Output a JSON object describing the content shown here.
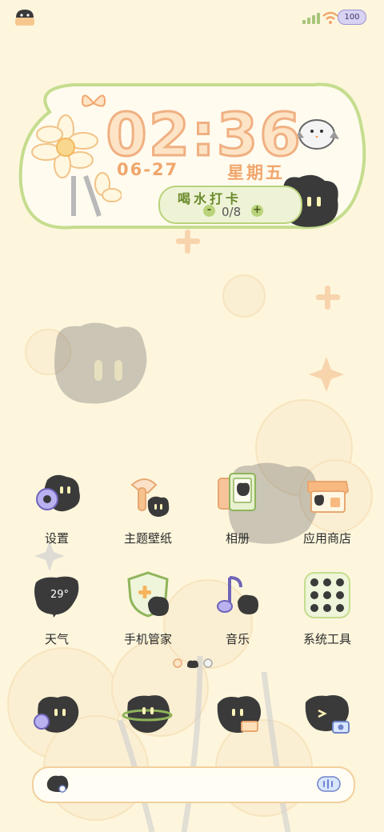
{
  "status_bar": {
    "battery_level": "100",
    "icons": [
      "signal-icon",
      "wifi-icon",
      "battery-icon"
    ]
  },
  "clock_widget": {
    "time": "02:36",
    "date": "06-27",
    "weekday": "星期五",
    "water": {
      "label": "喝水打卡",
      "count": "0/8",
      "minus": "-",
      "plus": "+"
    }
  },
  "apps": [
    {
      "label": "设置",
      "icon": "settings-gear-icon"
    },
    {
      "label": "主题壁纸",
      "icon": "paint-brush-icon"
    },
    {
      "label": "相册",
      "icon": "photo-album-icon"
    },
    {
      "label": "应用商店",
      "icon": "app-store-icon"
    },
    {
      "label": "天气",
      "icon": "weather-icon",
      "temperature": "29°"
    },
    {
      "label": "手机管家",
      "icon": "phone-manager-shield-icon"
    },
    {
      "label": "音乐",
      "icon": "music-note-icon"
    },
    {
      "label": "系统工具",
      "icon": "system-tools-folder-icon"
    }
  ],
  "page_indicator": {
    "pages": 3,
    "current": 2
  },
  "dock": [
    {
      "icon": "phone-call-icon"
    },
    {
      "icon": "messages-icon"
    },
    {
      "icon": "browser-icon"
    },
    {
      "icon": "camera-icon"
    }
  ],
  "colors": {
    "background": "#fdf6dd",
    "accent_orange": "#f0a66c",
    "accent_green": "#b9d37a",
    "character": "#3a3a3a"
  }
}
